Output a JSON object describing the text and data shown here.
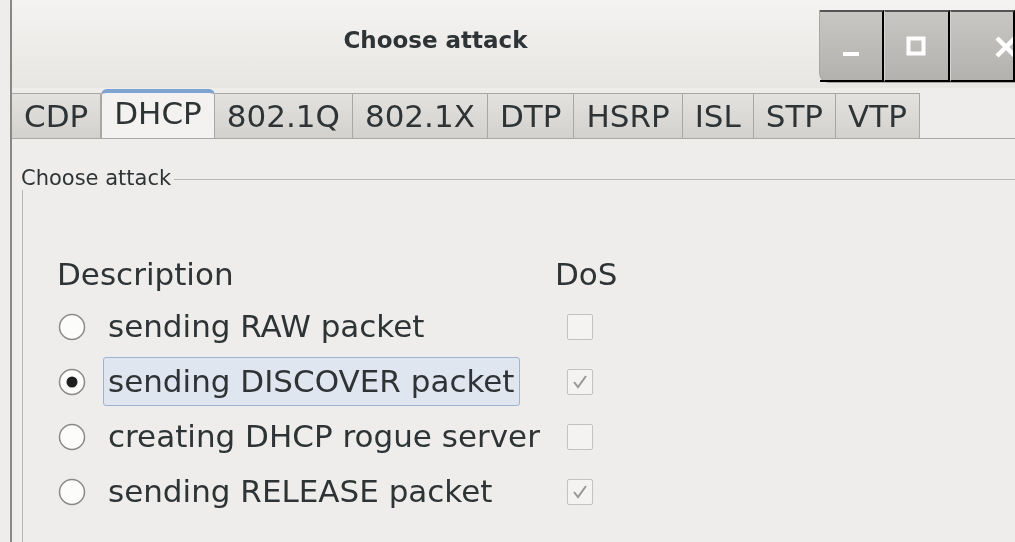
{
  "window": {
    "title": "Choose attack"
  },
  "tabs": [
    {
      "label": "CDP",
      "selected": false
    },
    {
      "label": "DHCP",
      "selected": true
    },
    {
      "label": "802.1Q",
      "selected": false
    },
    {
      "label": "802.1X",
      "selected": false
    },
    {
      "label": "DTP",
      "selected": false
    },
    {
      "label": "HSRP",
      "selected": false
    },
    {
      "label": "ISL",
      "selected": false
    },
    {
      "label": "STP",
      "selected": false
    },
    {
      "label": "VTP",
      "selected": false
    }
  ],
  "frame": {
    "title": "Choose attack",
    "columns": [
      "Description",
      "DoS"
    ]
  },
  "attacks": [
    {
      "description": "sending RAW packet",
      "selected": false,
      "dos": false
    },
    {
      "description": "sending DISCOVER packet",
      "selected": true,
      "dos": true
    },
    {
      "description": "creating DHCP rogue server",
      "selected": false,
      "dos": false
    },
    {
      "description": "sending RELEASE packet",
      "selected": false,
      "dos": true
    }
  ]
}
